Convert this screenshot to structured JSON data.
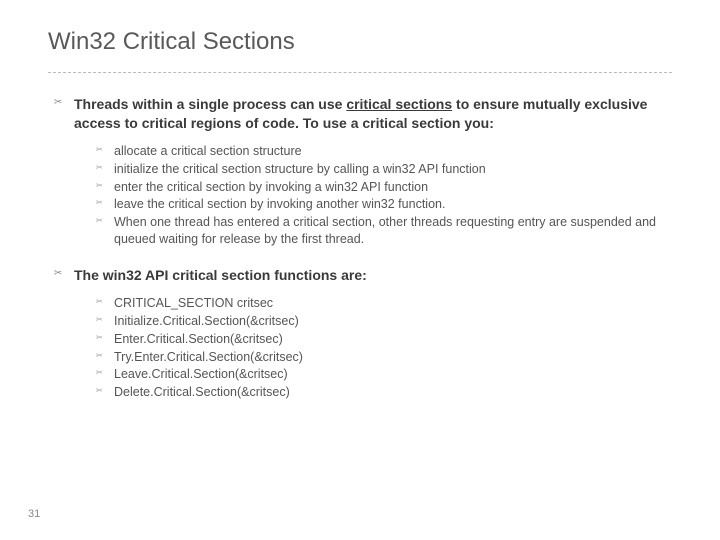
{
  "title": "Win32 Critical Sections",
  "page_number": "31",
  "points": [
    {
      "text_pre": "Threads within a single process can use ",
      "text_underline": "critical sections",
      "text_post": " to ensure mutually exclusive access to critical regions of code.  To use a critical section you:",
      "subs": [
        "allocate a critical section structure",
        "initialize the critical section structure by calling a win32 API function",
        "enter the critical section by invoking a win32 API function",
        "leave the critical section by invoking another win32 function.",
        "When one thread has entered a critical section, other threads requesting entry are suspended and queued waiting for release by the first thread."
      ]
    },
    {
      "text_pre": "The win32 API critical section functions are:",
      "text_underline": "",
      "text_post": "",
      "subs": [
        "CRITICAL_SECTION critsec",
        "Initialize.Critical.Section(&critsec)",
        "Enter.Critical.Section(&critsec)",
        "Try.Enter.Critical.Section(&critsec)",
        "Leave.Critical.Section(&critsec)",
        "Delete.Critical.Section(&critsec)"
      ]
    }
  ]
}
